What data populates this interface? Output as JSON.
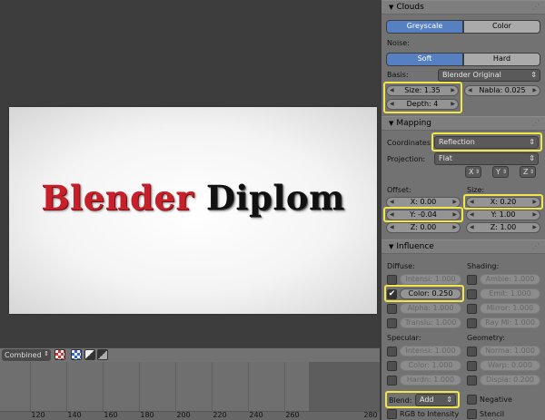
{
  "viewport": {
    "logo_word1": "Blender",
    "logo_word2": "Diplom"
  },
  "header_bar": {
    "pass_select": "Combined"
  },
  "timeline": {
    "ticks": [
      "120",
      "140",
      "160",
      "180",
      "200",
      "220",
      "240",
      "260",
      "280"
    ]
  },
  "clouds": {
    "title": "Clouds",
    "tabs": [
      "Greyscale",
      "Color"
    ],
    "noise_label": "Noise:",
    "noise_tabs": [
      "Soft",
      "Hard"
    ],
    "basis_label": "Basis:",
    "basis_value": "Blender Original",
    "size": "Size: 1.35",
    "nabla": "Nabla: 0.025",
    "depth": "Depth: 4"
  },
  "mapping": {
    "title": "Mapping",
    "coordinates_label": "Coordinates:",
    "coordinates_value": "Reflection",
    "projection_label": "Projection:",
    "projection_value": "Flat",
    "axes": [
      "X",
      "Y",
      "Z"
    ],
    "offset_label": "Offset:",
    "size_label": "Size:",
    "offset": [
      "X: 0.00",
      "Y: -0.04",
      "Z: 0.00"
    ],
    "size": [
      "X: 0.20",
      "Y: 1.00",
      "Z: 1.00"
    ]
  },
  "influence": {
    "title": "Influence",
    "diffuse_label": "Diffuse:",
    "shading_label": "Shading:",
    "diffuse": [
      "Intensi: 1.000",
      "Color: 0.250",
      "Alpha: 1.000",
      "Translu: 1.000"
    ],
    "shading": [
      "Ambie: 1.000",
      "Emit: 1.000",
      "Mirror: 1.000",
      "Ray Mi: 1.000"
    ],
    "specular_label": "Specular:",
    "geometry_label": "Geometry:",
    "specular": [
      "Intensi: 1.000",
      "Color: 1.000",
      "Hardn: 1.000"
    ],
    "geometry": [
      "Norma: 1.000",
      "Warp: 0.000",
      "Displa: 0.200"
    ],
    "blend_label": "Blend:",
    "blend_value": "Add",
    "negative_label": "Negative",
    "rgb_label": "RGB to Intensity",
    "stencil_label": "Stencil"
  },
  "colors": {
    "accent_blue": "#5680c2",
    "highlight_yellow": "#f0e64a",
    "logo_red": "#c8202a"
  }
}
